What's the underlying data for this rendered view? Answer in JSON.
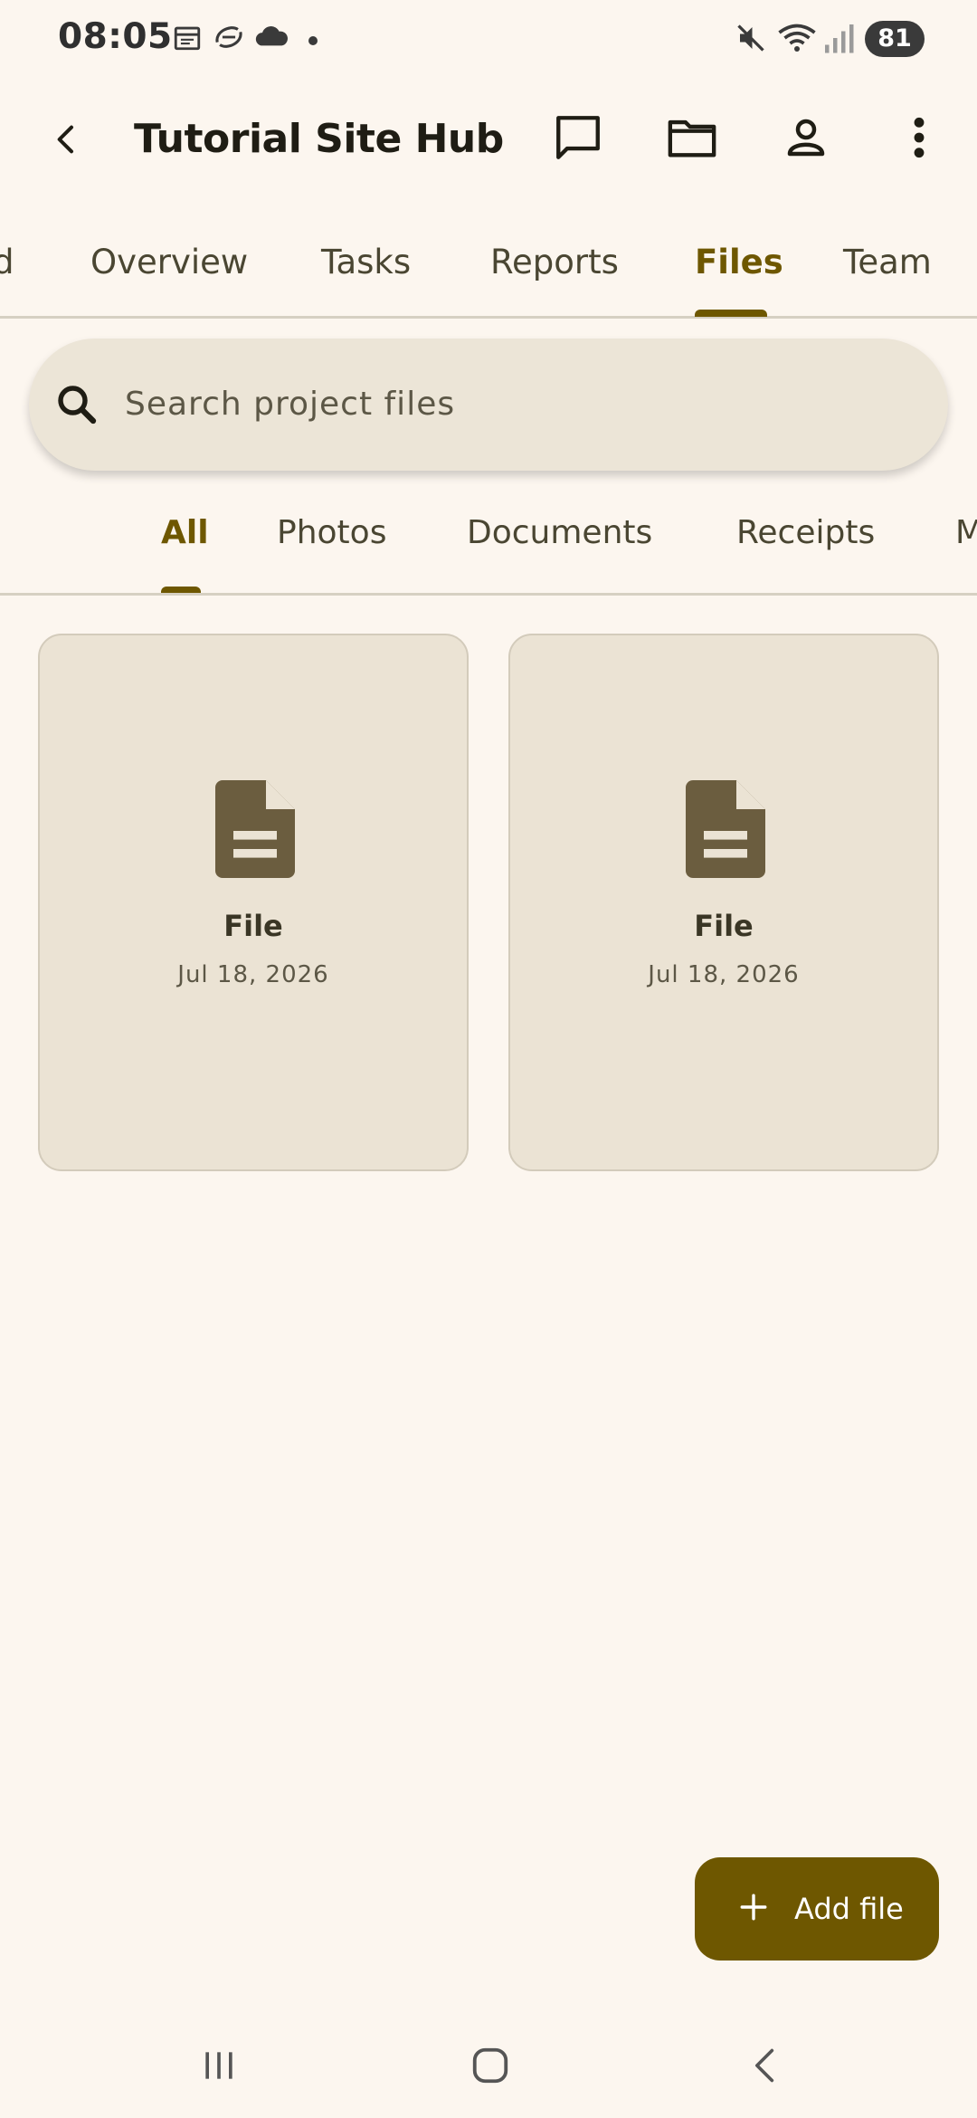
{
  "status_bar": {
    "time": "08:05",
    "battery": "81",
    "icons": [
      "calendar-icon",
      "sync-icon",
      "cloud-icon",
      "dot-icon",
      "mute-icon",
      "wifi-icon",
      "signal-icon",
      "battery-icon"
    ]
  },
  "app_bar": {
    "title": "Tutorial Site Hub",
    "actions": [
      "back-icon",
      "chat-icon",
      "folder-icon",
      "profile-icon",
      "more-vert-icon"
    ]
  },
  "tabs": {
    "items": [
      {
        "label": "d"
      },
      {
        "label": "Overview"
      },
      {
        "label": "Tasks"
      },
      {
        "label": "Reports"
      },
      {
        "label": "Files",
        "active": true
      },
      {
        "label": "Team"
      }
    ]
  },
  "search": {
    "placeholder": "Search project files",
    "value": ""
  },
  "filters": {
    "items": [
      {
        "label": "All",
        "active": true
      },
      {
        "label": "Photos"
      },
      {
        "label": "Documents"
      },
      {
        "label": "Receipts"
      },
      {
        "label": "M"
      }
    ]
  },
  "files": [
    {
      "name": "File",
      "date": "Jul 18, 2026",
      "icon": "document-icon"
    },
    {
      "name": "File",
      "date": "Jul 18, 2026",
      "icon": "document-icon"
    }
  ],
  "fab": {
    "label": "Add file",
    "icon": "plus-icon"
  },
  "colors": {
    "background": "#fcf6ef",
    "accent": "#6e5700",
    "card": "#ebe3d4",
    "search_bg": "#ece5d7"
  },
  "nav_bar": {
    "buttons": [
      "recents-icon",
      "home-icon",
      "back-nav-icon"
    ]
  }
}
